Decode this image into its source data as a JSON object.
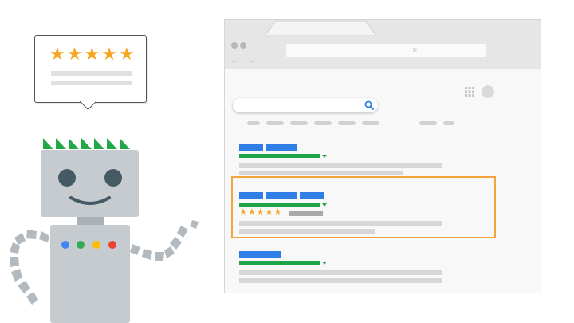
{
  "bubble": {
    "rating": 5,
    "stars": [
      "★",
      "★",
      "★",
      "★",
      "★"
    ]
  },
  "browser": {
    "address_close_glyph": "×",
    "nav_back_glyph": "←",
    "nav_forward_glyph": "→"
  },
  "results": [
    {
      "highlighted": false,
      "has_rating": false
    },
    {
      "highlighted": true,
      "has_rating": true,
      "rating": 5,
      "stars": [
        "★",
        "★",
        "★",
        "★",
        "★"
      ]
    },
    {
      "highlighted": false,
      "has_rating": false
    }
  ],
  "colors": {
    "title_blue": "#2f7fe6",
    "url_green": "#1ea446",
    "star_gold": "#f5a623",
    "highlight_orange": "#f3a43b",
    "robot_gray": "#c6cbcf",
    "robot_dark": "#455a64",
    "robot_hair_green": "#22a84a",
    "robot_buttons": [
      "#4285f4",
      "#34a853",
      "#fbbc05",
      "#ea4335"
    ]
  },
  "icons": [
    "star-icon",
    "search-icon",
    "apps-grid-icon",
    "close-icon",
    "back-arrow-icon",
    "forward-arrow-icon",
    "avatar"
  ]
}
